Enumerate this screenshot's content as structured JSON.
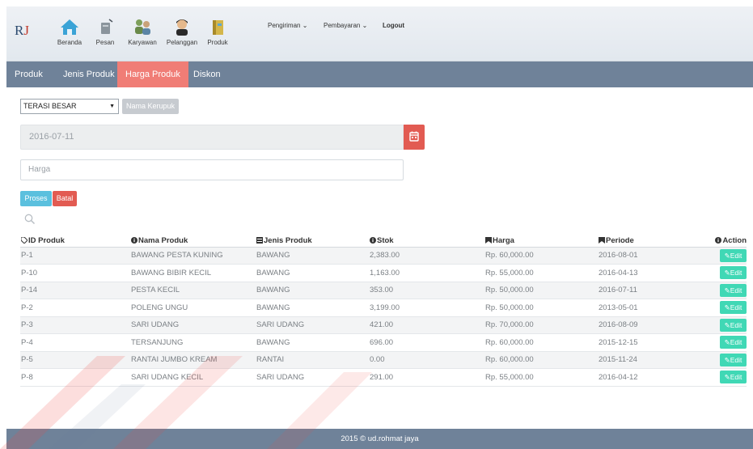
{
  "brand": {
    "r": "R",
    "j": "J"
  },
  "toolbar": [
    {
      "label": "Beranda",
      "icon": "home-icon"
    },
    {
      "label": "Pesan",
      "icon": "message-icon"
    },
    {
      "label": "Karyawan",
      "icon": "employees-icon"
    },
    {
      "label": "Pelanggan",
      "icon": "customer-icon"
    },
    {
      "label": "Produk",
      "icon": "product-icon"
    }
  ],
  "topmenu": {
    "pengiriman": "Pengiriman ⌄",
    "pembayaran": "Pembayaran ⌄",
    "logout": "Logout"
  },
  "nav": {
    "tabs": [
      "Produk",
      "Jenis Produk",
      "Harga Produk",
      "Diskon"
    ],
    "active": "Harga Produk"
  },
  "form": {
    "select_value": "TERASI BESAR",
    "nama_button": "Nama Kerupuk",
    "date_value": "2016-07-11",
    "harga_placeholder": "Harga",
    "proses": "Proses",
    "batal": "Batal"
  },
  "table": {
    "headers": [
      "ID Produk",
      "Nama Produk",
      "Jenis Produk",
      "Stok",
      "Harga",
      "Periode",
      "Action"
    ],
    "rows": [
      [
        "P-1",
        "BAWANG PESTA KUNING",
        "BAWANG",
        "2,383.00",
        "Rp. 60,000.00",
        "2016-08-01"
      ],
      [
        "P-10",
        "BAWANG BIBIR KECIL",
        "BAWANG",
        "1,163.00",
        "Rp. 55,000.00",
        "2016-04-13"
      ],
      [
        "P-14",
        "PESTA KECIL",
        "BAWANG",
        "353.00",
        "Rp. 50,000.00",
        "2016-07-11"
      ],
      [
        "P-2",
        "POLENG UNGU",
        "BAWANG",
        "3,199.00",
        "Rp. 50,000.00",
        "2013-05-01"
      ],
      [
        "P-3",
        "SARI UDANG",
        "SARI UDANG",
        "421.00",
        "Rp. 70,000.00",
        "2016-08-09"
      ],
      [
        "P-4",
        "TERSANJUNG",
        "BAWANG",
        "696.00",
        "Rp. 60,000.00",
        "2015-12-15"
      ],
      [
        "P-5",
        "RANTAI JUMBO KREAM",
        "RANTAI",
        "0.00",
        "Rp. 60,000.00",
        "2015-11-24"
      ],
      [
        "P-8",
        "SARI UDANG KECIL",
        "SARI UDANG",
        "291.00",
        "Rp. 55,000.00",
        "2016-04-12"
      ]
    ],
    "edit_label": "Edit"
  },
  "footer": {
    "text": "2015 © ud.rohmat jaya"
  },
  "colors": {
    "nav": "#6f8299",
    "active_tab": "#f07d76",
    "danger": "#e25b52",
    "info": "#5bc0de",
    "edit": "#40d8b5"
  }
}
